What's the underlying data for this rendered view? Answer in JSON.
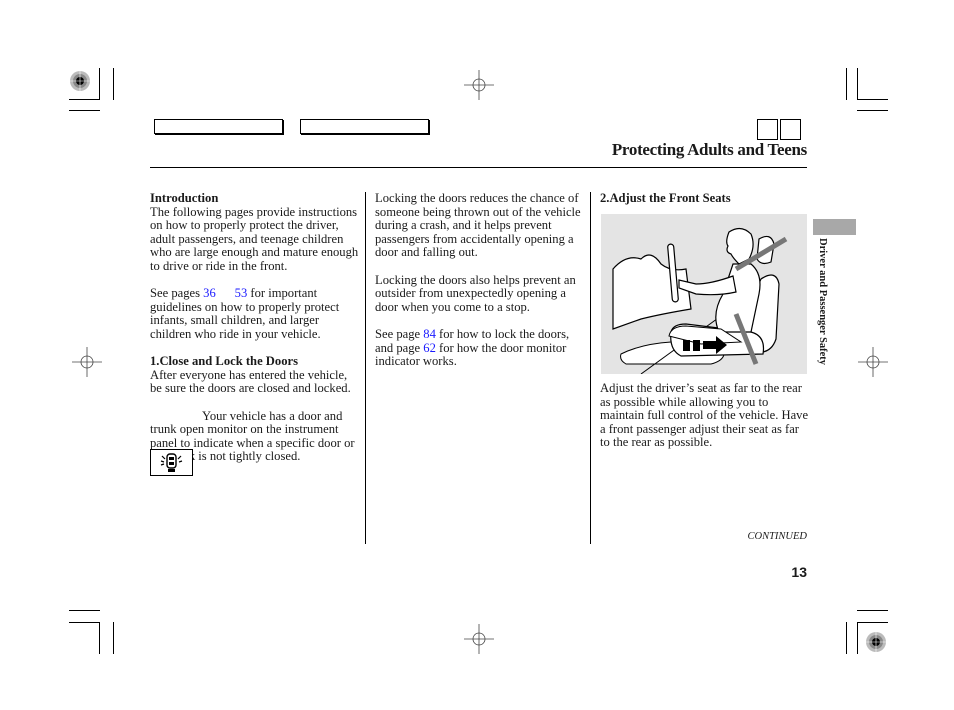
{
  "header": {
    "title": "Protecting Adults and Teens",
    "nav_tabs": [
      "",
      ""
    ],
    "nav_squares": [
      "",
      ""
    ]
  },
  "columns": {
    "left": {
      "intro_heading": "Introduction",
      "intro_text": "The following pages provide instructions on how to properly protect the driver, adult passengers, and teenage children who are large enough and mature enough to drive or ride in the front.",
      "see_pages_prefix": "See pages ",
      "see_pages_link1": "36",
      "see_pages_sep": "      ",
      "see_pages_link2": "53",
      "see_pages_suffix": " for important guidelines on how to properly protect infants, small children, and larger children who ride in your vehicle.",
      "section1_heading": "1.Close and Lock the Doors",
      "section1_text": "After everyone has entered the vehicle, be sure the doors are closed and locked.",
      "monitor_text": "Your vehicle has a door and trunk open monitor on the instrument panel to indicate when a specific door or the trunk is not tightly closed."
    },
    "middle": {
      "para1": "Locking the doors reduces the chance of someone being thrown out of the vehicle during a crash, and it helps prevent passengers from accidentally opening a door and falling out.",
      "para2": "Locking the doors also helps prevent an outsider from unexpectedly opening a door when you come to a stop.",
      "see_page_prefix": "See page ",
      "see_page_link1": "84",
      "see_page_mid": "  for how to lock the doors, and page ",
      "see_page_link2": "62",
      "see_page_suffix": " for how the door monitor indicator works."
    },
    "right": {
      "section2_heading": "2.Adjust the Front Seats",
      "figure_alt": "Driver seated with seat moved rearward, seat belt fastened, arrow indicating seat slides back",
      "section2_text": "Adjust the driver’s seat as far to the rear as possible while allowing you to maintain full control of the vehicle. Have a front passenger adjust their seat as far to the rear as possible."
    }
  },
  "side_tab": {
    "label": "Driver and Passenger Safety"
  },
  "footer": {
    "continued": "CONTINUED",
    "page_number": "13"
  },
  "colors": {
    "link": "#1a1aff",
    "figure_bg": "#e4e4e4",
    "side_tab": "#a8a8a8"
  }
}
